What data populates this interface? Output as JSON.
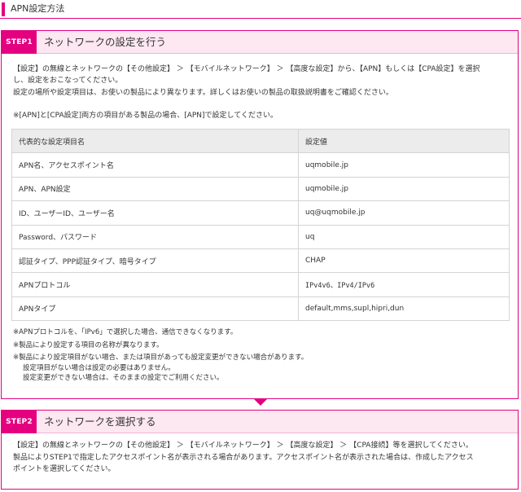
{
  "header": {
    "title": "APN設定方法"
  },
  "step1": {
    "badge": "STEP1",
    "title": "ネットワークの設定を行う",
    "desc_line1": "【設定】の無線とネットワークの【その他設定】 ＞ 【モバイルネットワーク】 ＞ 【高度な設定】から、【APN】もしくは【CPA設定】を選択",
    "desc_line2": "し、設定をおこなってください。",
    "desc_line3": "設定の場所や設定項目は、お使いの製品により異なります。詳しくはお使いの製品の取扱説明書をご確認ください。",
    "note": "※[APN]と[CPA設定]両方の項目がある製品の場合、[APN]で設定してください。",
    "table": {
      "headers": [
        "代表的な設定項目名",
        "設定値"
      ],
      "rows": [
        [
          "APN名、アクセスポイント名",
          "uqmobile.jp"
        ],
        [
          "APN、APN設定",
          "uqmobile.jp"
        ],
        [
          "ID、ユーザーID、ユーザー名",
          "uq@uqmobile.jp"
        ],
        [
          "Password、パスワード",
          "uq"
        ],
        [
          "認証タイプ、PPP認証タイプ、暗号タイプ",
          "CHAP"
        ],
        [
          "APNプロトコル",
          "IPv4v6、IPv4/IPv6"
        ],
        [
          "APNタイプ",
          "default,mms,supl,hipri,dun"
        ]
      ]
    },
    "notes": [
      "※APNプロトコルを、「IPv6」で選択した場合、通信できなくなります。",
      "※製品により設定する項目の名称が異なります。",
      "※製品により設定項目がない場合、または項目があっても設定変更ができない場合があります。",
      "設定項目がない場合は設定の必要はありません。",
      "設定変更ができない場合は、そのままの設定でご利用ください。"
    ]
  },
  "step2": {
    "badge": "STEP2",
    "title": "ネットワークを選択する",
    "desc_line1": "【設定】の無線とネットワークの【その他設定】 ＞ 【モバイルネットワーク】 ＞ 【高度な設定】 ＞ 【CPA接続】等を選択してください。",
    "desc_line2": "製品によりSTEP1で指定したアクセスポイント名が表示される場合があります。アクセスポイント名が表示された場合は、作成したアクセス",
    "desc_line3": "ポイントを選択してください。"
  },
  "colors": {
    "accent": "#e4007f",
    "step_header_bg": "#fde7f1",
    "table_header_bg": "#ececec"
  },
  "icons": {
    "connector": "triangle-down-icon"
  }
}
